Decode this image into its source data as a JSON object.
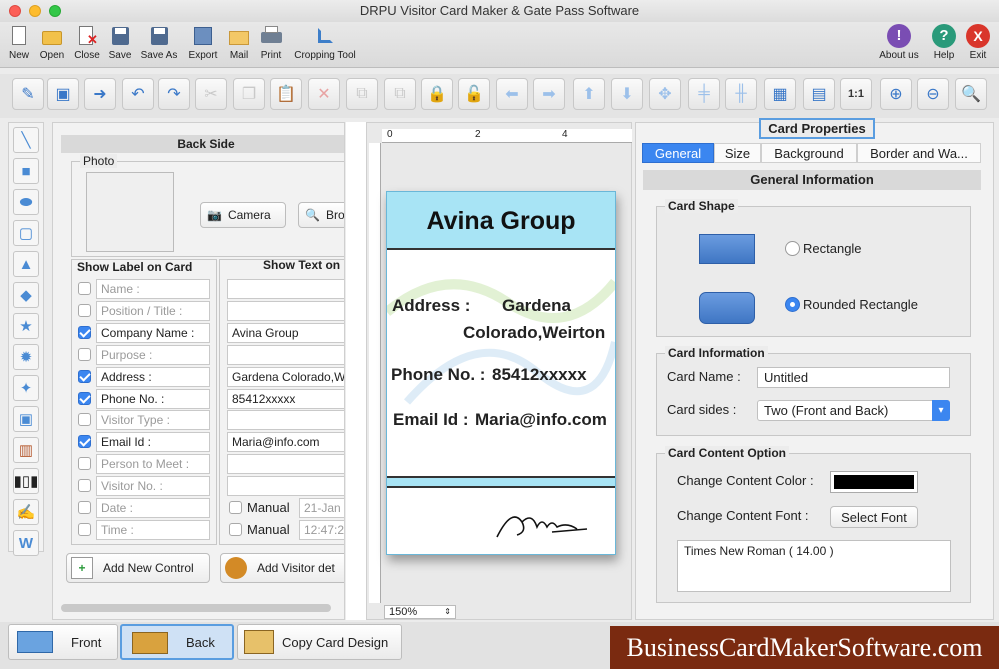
{
  "window": {
    "title": "DRPU Visitor Card Maker & Gate Pass Software"
  },
  "menu": {
    "items": [
      {
        "label": "New",
        "icon": "new-document-icon"
      },
      {
        "label": "Open",
        "icon": "open-folder-icon"
      },
      {
        "label": "Close",
        "icon": "close-document-icon"
      },
      {
        "label": "Save",
        "icon": "save-icon"
      },
      {
        "label": "Save As",
        "icon": "save-as-icon"
      },
      {
        "label": "Export",
        "icon": "export-icon"
      },
      {
        "label": "Mail",
        "icon": "mail-icon"
      },
      {
        "label": "Print",
        "icon": "printer-icon"
      },
      {
        "label": "Cropping Tool",
        "icon": "crop-icon"
      }
    ],
    "right_items": [
      {
        "label": "About us",
        "icon": "about-icon",
        "glyph": "!",
        "color": "#7a4db3"
      },
      {
        "label": "Help",
        "icon": "help-icon",
        "glyph": "?",
        "color": "#2a9a7a"
      },
      {
        "label": "Exit",
        "icon": "exit-icon",
        "glyph": "X",
        "color": "#d9362b"
      }
    ]
  },
  "toolbar": {
    "buttons": [
      "edit-document",
      "image",
      "export-image",
      "undo",
      "redo",
      "cut",
      "copy",
      "paste",
      "delete",
      "bring-front",
      "send-back",
      "lock",
      "unlock",
      "arrow-left",
      "arrow-right",
      "arrow-up",
      "arrow-down",
      "center",
      "align-horizontal",
      "align-vertical",
      "grid",
      "ruler",
      "actual-size",
      "zoom-in",
      "zoom-out",
      "preview"
    ]
  },
  "left_tools": [
    "line",
    "rectangle",
    "ellipse",
    "rounded-rectangle",
    "triangle",
    "diamond",
    "star",
    "burst",
    "cross-star",
    "image",
    "library",
    "barcode",
    "signature",
    "word-art"
  ],
  "back_side": {
    "title": "Back Side",
    "photo": {
      "label": "Photo",
      "camera_label": "Camera",
      "browse_label": "Bro"
    },
    "show_label_header": "Show Label on Card",
    "show_text_header": "Show Text on",
    "rows": [
      {
        "label": "Name :",
        "checked": false,
        "value": ""
      },
      {
        "label": "Position / Title :",
        "checked": false,
        "value": ""
      },
      {
        "label": "Company Name :",
        "checked": true,
        "value": "Avina Group"
      },
      {
        "label": "Purpose :",
        "checked": false,
        "value": ""
      },
      {
        "label": "Address :",
        "checked": true,
        "value": "Gardena Colorado,W"
      },
      {
        "label": "Phone No. :",
        "checked": true,
        "value": "85412xxxxx"
      },
      {
        "label": "Visitor Type :",
        "checked": false,
        "value": ""
      },
      {
        "label": "Email Id :",
        "checked": true,
        "value": "Maria@info.com"
      },
      {
        "label": "Person to Meet :",
        "checked": false,
        "value": ""
      },
      {
        "label": "Visitor No. :",
        "checked": false,
        "value": ""
      },
      {
        "label": "Date :",
        "checked": false,
        "value": "",
        "manual_label": "Manual",
        "manual_value": "21-Jan"
      },
      {
        "label": "Time :",
        "checked": false,
        "value": "",
        "manual_label": "Manual",
        "manual_value": "12:47:2"
      }
    ],
    "add_control_label": "Add New Control",
    "add_visitor_label": "Add Visitor det"
  },
  "canvas": {
    "ruler_marks": [
      "0",
      "2",
      "4"
    ],
    "zoom": "150%",
    "card": {
      "company": "Avina Group",
      "address_label": "Address :",
      "address_line1": "Gardena",
      "address_line2": "Colorado,Weirton",
      "phone_label": "Phone No. :",
      "phone_value": "85412xxxxx",
      "email_label": "Email Id :",
      "email_value": "Maria@info.com",
      "header_color": "#a8e4f5"
    }
  },
  "properties": {
    "title": "Card Properties",
    "tabs": [
      {
        "label": "General",
        "active": true
      },
      {
        "label": "Size",
        "active": false
      },
      {
        "label": "Background",
        "active": false
      },
      {
        "label": "Border and Wa...",
        "active": false
      }
    ],
    "section_title": "General Information",
    "card_shape": {
      "title": "Card Shape",
      "options": [
        {
          "label": "Rectangle",
          "selected": false
        },
        {
          "label": "Rounded Rectangle",
          "selected": true
        }
      ]
    },
    "card_info": {
      "title": "Card Information",
      "name_label": "Card Name :",
      "name_value": "Untitled",
      "sides_label": "Card sides :",
      "sides_value": "Two (Front and Back)"
    },
    "content_option": {
      "title": "Card Content Option",
      "color_label": "Change Content Color :",
      "color_value": "#000000",
      "font_label": "Change Content Font :",
      "font_button": "Select Font",
      "font_value": "Times New Roman ( 14.00 )"
    }
  },
  "bottom": {
    "front_label": "Front",
    "back_label": "Back",
    "copy_label": "Copy Card Design",
    "watermark": "BusinessCardMakerSoftware.com"
  }
}
